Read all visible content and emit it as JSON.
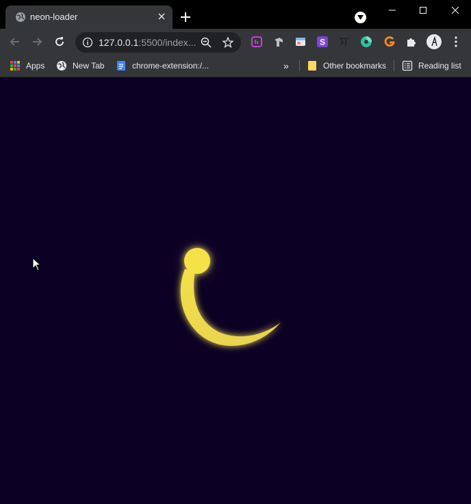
{
  "tab": {
    "title": "neon-loader"
  },
  "omnibox": {
    "url_host": "127.0.0.1",
    "url_rest": ":5500/index..."
  },
  "bookmarks": {
    "items": [
      {
        "label": "Apps",
        "icon": "apps-grid-icon"
      },
      {
        "label": "New Tab",
        "icon": "globe-icon"
      },
      {
        "label": "chrome-extension:/...",
        "icon": "doc-icon"
      }
    ],
    "overflow": "»",
    "other": "Other bookmarks",
    "reading_list": "Reading list"
  },
  "extensions": [
    "ext-purple-icon",
    "ext-gray-icon",
    "ext-window-icon",
    "ext-s-icon",
    "ext-devanagari-icon",
    "ext-teal-icon",
    "ext-g-icon",
    "puzzle-icon"
  ],
  "colors": {
    "page_background": "#0c0124",
    "loader_color": "#f5e24a",
    "chrome_dark": "#35363a"
  }
}
